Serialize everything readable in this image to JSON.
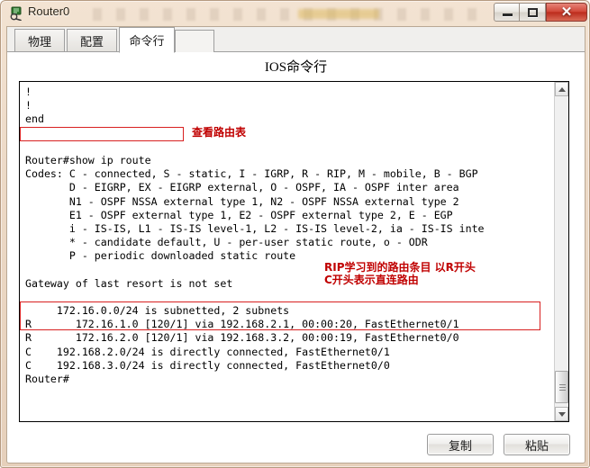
{
  "window": {
    "title": "Router0",
    "icon": "router-icon",
    "controls": {
      "minimize": "minimize-icon",
      "maximize": "maximize-icon",
      "close": "✕"
    }
  },
  "tabs": [
    {
      "label": "物理",
      "active": false
    },
    {
      "label": "配置",
      "active": false
    },
    {
      "label": "命令行",
      "active": true
    }
  ],
  "panel": {
    "title": "IOS命令行"
  },
  "terminal": {
    "lines": [
      "!",
      "!",
      "end",
      "",
      "",
      "Router#show ip route",
      "Codes: C - connected, S - static, I - IGRP, R - RIP, M - mobile, B - BGP",
      "       D - EIGRP, EX - EIGRP external, O - OSPF, IA - OSPF inter area",
      "       N1 - OSPF NSSA external type 1, N2 - OSPF NSSA external type 2",
      "       E1 - OSPF external type 1, E2 - OSPF external type 2, E - EGP",
      "       i - IS-IS, L1 - IS-IS level-1, L2 - IS-IS level-2, ia - IS-IS inte",
      "       * - candidate default, U - per-user static route, o - ODR",
      "       P - periodic downloaded static route",
      "",
      "Gateway of last resort is not set",
      "",
      "     172.16.0.0/24 is subnetted, 2 subnets",
      "R       172.16.1.0 [120/1] via 192.168.2.1, 00:00:20, FastEthernet0/1",
      "R       172.16.2.0 [120/1] via 192.168.3.2, 00:00:19, FastEthernet0/0",
      "C    192.168.2.0/24 is directly connected, FastEthernet0/1",
      "C    192.168.3.0/24 is directly connected, FastEthernet0/0",
      "Router#"
    ]
  },
  "annotations": {
    "command_note": "查看路由表",
    "route_note": "RIP学习到的路由条目 以R开头\nC开头表示直连路由"
  },
  "buttons": {
    "copy": "复制",
    "paste": "粘贴"
  },
  "colors": {
    "annotation_red": "#c00000",
    "box_red": "#d82020",
    "frame_beige": "#ecd9c6",
    "close_red": "#d2493a"
  }
}
